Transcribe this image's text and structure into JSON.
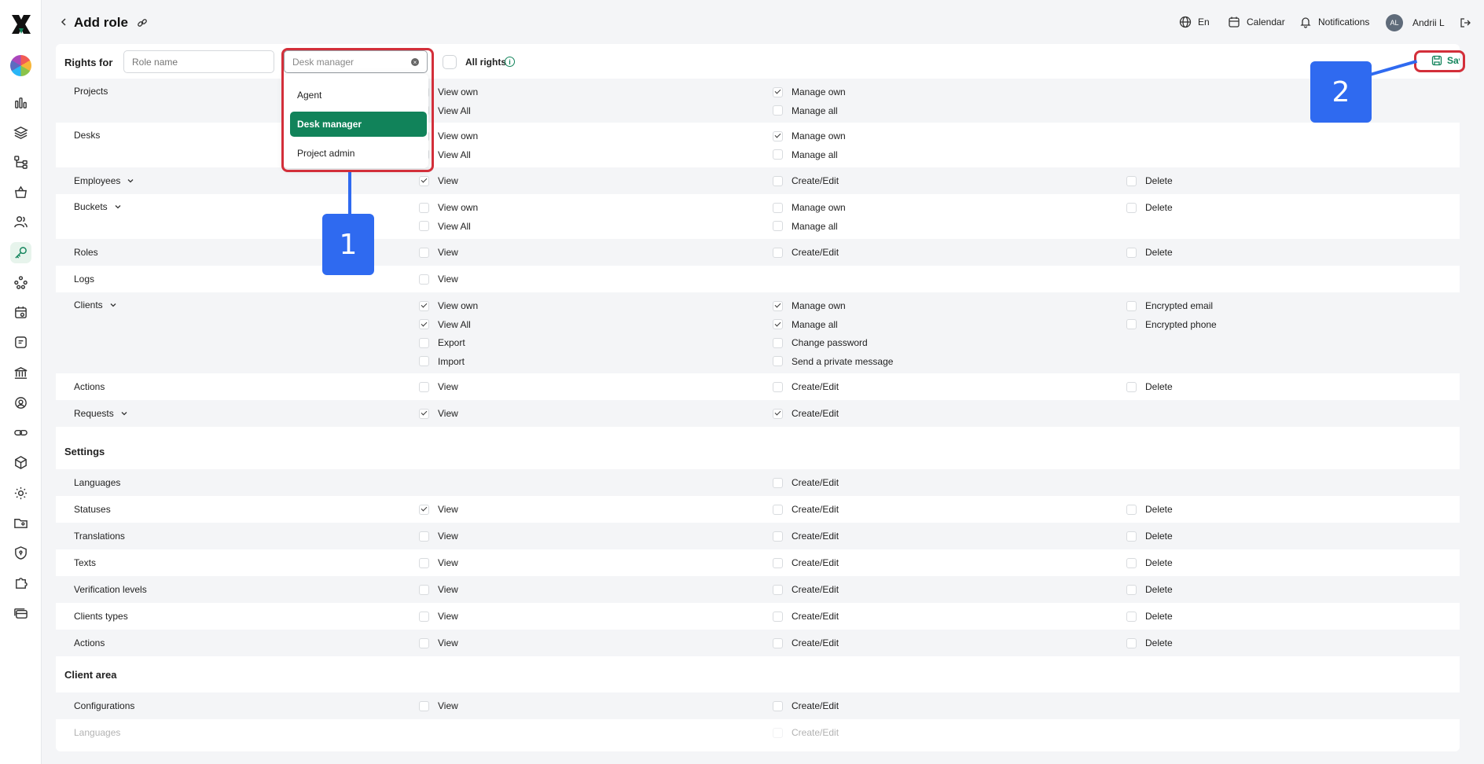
{
  "header": {
    "title": "Add role",
    "language": "En",
    "calendar": "Calendar",
    "notifications": "Notifications",
    "avatar_initials": "AL",
    "user_name": "Andrii L"
  },
  "form": {
    "rights_for": "Rights for",
    "role_name_placeholder": "Role name",
    "desk_placeholder": "Desk manager",
    "all_rights": "All rights",
    "save": "Save"
  },
  "dropdown": {
    "options": [
      "Agent",
      "Desk manager",
      "Project admin"
    ],
    "selected": "Desk manager"
  },
  "annotations": {
    "badge1": "1",
    "badge2": "2"
  },
  "sections": {
    "settings": "Settings",
    "client_area": "Client area"
  },
  "rows": [
    {
      "label": "Projects",
      "perms": [
        [
          "View own",
          "View All"
        ],
        [
          "Manage own",
          "Manage all"
        ],
        []
      ],
      "checked": [
        [
          false,
          false
        ],
        [
          true,
          false
        ],
        []
      ]
    },
    {
      "label": "Desks",
      "perms": [
        [
          "View own",
          "View All"
        ],
        [
          "Manage own",
          "Manage all"
        ],
        []
      ],
      "checked": [
        [
          false,
          false
        ],
        [
          true,
          false
        ],
        []
      ]
    },
    {
      "label": "Employees",
      "perms": [
        [
          "View"
        ],
        [
          "Create/Edit"
        ],
        [
          "Delete"
        ]
      ],
      "checked": [
        [
          true
        ],
        [
          false
        ],
        [
          false
        ]
      ]
    },
    {
      "label": "Buckets",
      "perms": [
        [
          "View own",
          "View All"
        ],
        [
          "Manage own",
          "Manage all"
        ],
        [
          "Delete"
        ]
      ],
      "checked": [
        [
          false,
          false
        ],
        [
          false,
          false
        ],
        [
          false
        ]
      ]
    },
    {
      "label": "Roles",
      "perms": [
        [
          "View"
        ],
        [
          "Create/Edit"
        ],
        [
          "Delete"
        ]
      ],
      "checked": [
        [
          false
        ],
        [
          false
        ],
        [
          false
        ]
      ]
    },
    {
      "label": "Logs",
      "perms": [
        [
          "View"
        ],
        [],
        []
      ],
      "checked": [
        [
          false
        ],
        [],
        []
      ]
    },
    {
      "label": "Clients",
      "perms": [
        [
          "View own",
          "View All",
          "Export",
          "Import"
        ],
        [
          "Manage own",
          "Manage all",
          "Change password",
          "Send a private message"
        ],
        [
          "Encrypted email",
          "Encrypted phone"
        ]
      ],
      "checked": [
        [
          true,
          true,
          false,
          false
        ],
        [
          true,
          true,
          false,
          false
        ],
        [
          false,
          false
        ]
      ]
    },
    {
      "label": "Actions",
      "perms": [
        [
          "View"
        ],
        [
          "Create/Edit"
        ],
        [
          "Delete"
        ]
      ],
      "checked": [
        [
          false
        ],
        [
          false
        ],
        [
          false
        ]
      ]
    },
    {
      "label": "Requests",
      "perms": [
        [
          "View"
        ],
        [
          "Create/Edit"
        ],
        []
      ],
      "checked": [
        [
          true
        ],
        [
          true
        ],
        []
      ]
    },
    {
      "label": "Languages",
      "perms": [
        [],
        [
          "Create/Edit"
        ],
        []
      ],
      "checked": [
        [],
        [
          false
        ],
        []
      ]
    },
    {
      "label": "Statuses",
      "perms": [
        [
          "View"
        ],
        [
          "Create/Edit"
        ],
        [
          "Delete"
        ]
      ],
      "checked": [
        [
          true
        ],
        [
          false
        ],
        [
          false
        ]
      ]
    },
    {
      "label": "Translations",
      "perms": [
        [
          "View"
        ],
        [
          "Create/Edit"
        ],
        [
          "Delete"
        ]
      ],
      "checked": [
        [
          false
        ],
        [
          false
        ],
        [
          false
        ]
      ]
    },
    {
      "label": "Texts",
      "perms": [
        [
          "View"
        ],
        [
          "Create/Edit"
        ],
        [
          "Delete"
        ]
      ],
      "checked": [
        [
          false
        ],
        [
          false
        ],
        [
          false
        ]
      ]
    },
    {
      "label": "Verification levels",
      "perms": [
        [
          "View"
        ],
        [
          "Create/Edit"
        ],
        [
          "Delete"
        ]
      ],
      "checked": [
        [
          false
        ],
        [
          false
        ],
        [
          false
        ]
      ]
    },
    {
      "label": "Clients types",
      "perms": [
        [
          "View"
        ],
        [
          "Create/Edit"
        ],
        [
          "Delete"
        ]
      ],
      "checked": [
        [
          false
        ],
        [
          false
        ],
        [
          false
        ]
      ]
    },
    {
      "label": "Actions",
      "perms": [
        [
          "View"
        ],
        [
          "Create/Edit"
        ],
        [
          "Delete"
        ]
      ],
      "checked": [
        [
          false
        ],
        [
          false
        ],
        [
          false
        ]
      ]
    },
    {
      "label": "Configurations",
      "perms": [
        [
          "View"
        ],
        [
          "Create/Edit"
        ],
        []
      ],
      "checked": [
        [
          false
        ],
        [
          false
        ],
        []
      ]
    },
    {
      "label": "Languages",
      "perms": [
        [],
        [
          "Create/Edit"
        ],
        []
      ],
      "checked": [
        [],
        [
          false
        ],
        []
      ]
    }
  ]
}
